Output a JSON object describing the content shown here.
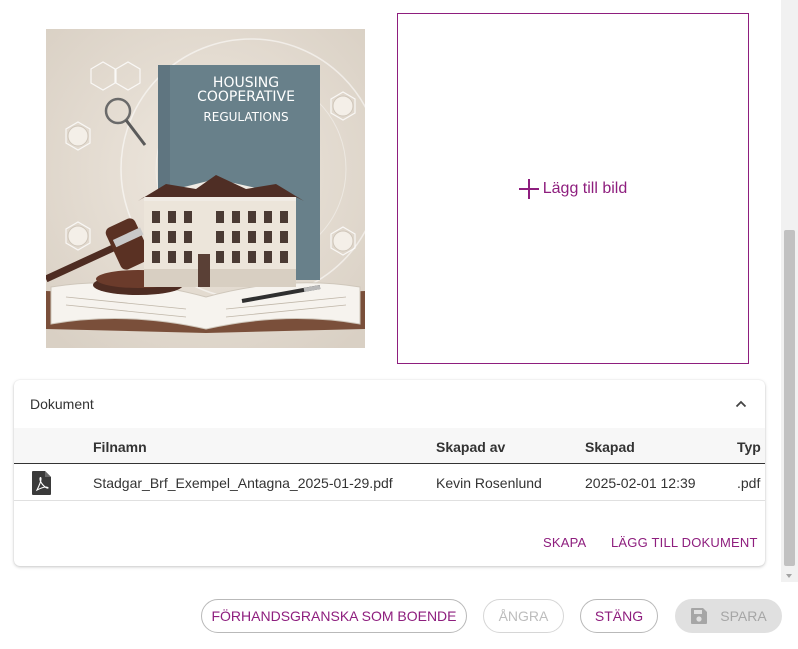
{
  "image": {
    "alt_title_line1": "HOUSING",
    "alt_title_line2": "COOPERATIVE",
    "alt_title_line3": "REGULATIONS"
  },
  "add_image": {
    "label": "Lägg till bild",
    "icon": "plus-icon"
  },
  "documents": {
    "title": "Dokument",
    "collapse_icon": "chevron-up-icon",
    "columns": [
      "Filnamn",
      "Skapad av",
      "Skapad",
      "Typ"
    ],
    "rows": [
      {
        "icon": "pdf-file-icon",
        "filename": "Stadgar_Brf_Exempel_Antagna_2025-01-29.pdf",
        "created_by": "Kevin Rosenlund",
        "created": "2025-02-01 12:39",
        "type": ".pdf"
      }
    ],
    "actions": {
      "create": "SKAPA",
      "add": "LÄGG TILL DOKUMENT"
    }
  },
  "footer": {
    "preview": "FÖRHANDSGRANSKA SOM BOENDE",
    "undo": "ÅNGRA",
    "close": "STÄNG",
    "save": "SPARA",
    "save_icon": "save-icon"
  },
  "colors": {
    "accent": "#8e1e7e",
    "disabled": "#bdbdbd"
  }
}
